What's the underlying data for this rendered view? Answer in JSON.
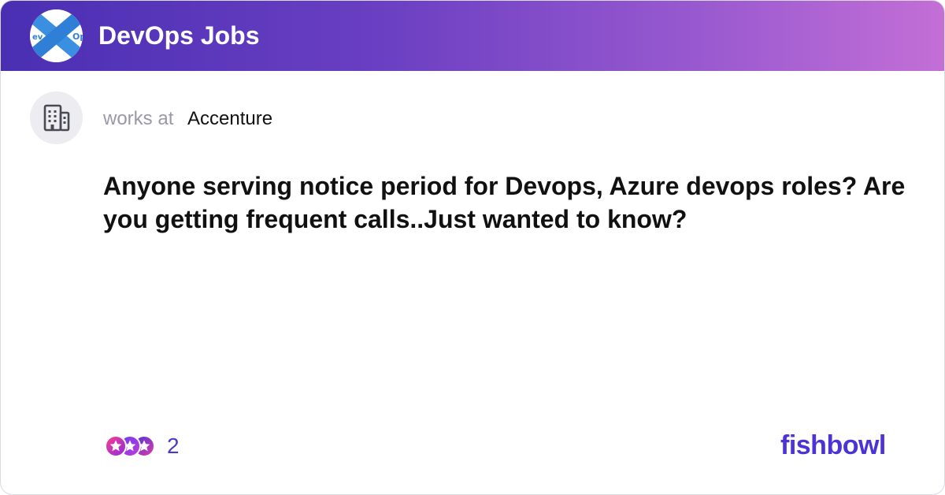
{
  "header": {
    "bowl_title": "DevOps Jobs",
    "logo_icon": "devops-bowl-logo-icon"
  },
  "post": {
    "works_at_label": "works at",
    "company": "Accenture",
    "company_icon": "building-icon",
    "body": "Anyone serving notice period for Devops, Azure devops roles? Are you getting frequent calls..Just wanted to know?"
  },
  "footer": {
    "reaction_icons": [
      "heart-reaction-icon",
      "star-reaction-icon",
      "star-reaction-icon"
    ],
    "reaction_count": "2",
    "brand": "fishbowl"
  },
  "colors": {
    "header_gradient_start": "#4a2fb3",
    "header_gradient_end": "#c36fd6",
    "brand": "#4b33d6",
    "count": "#4a3ac8"
  }
}
